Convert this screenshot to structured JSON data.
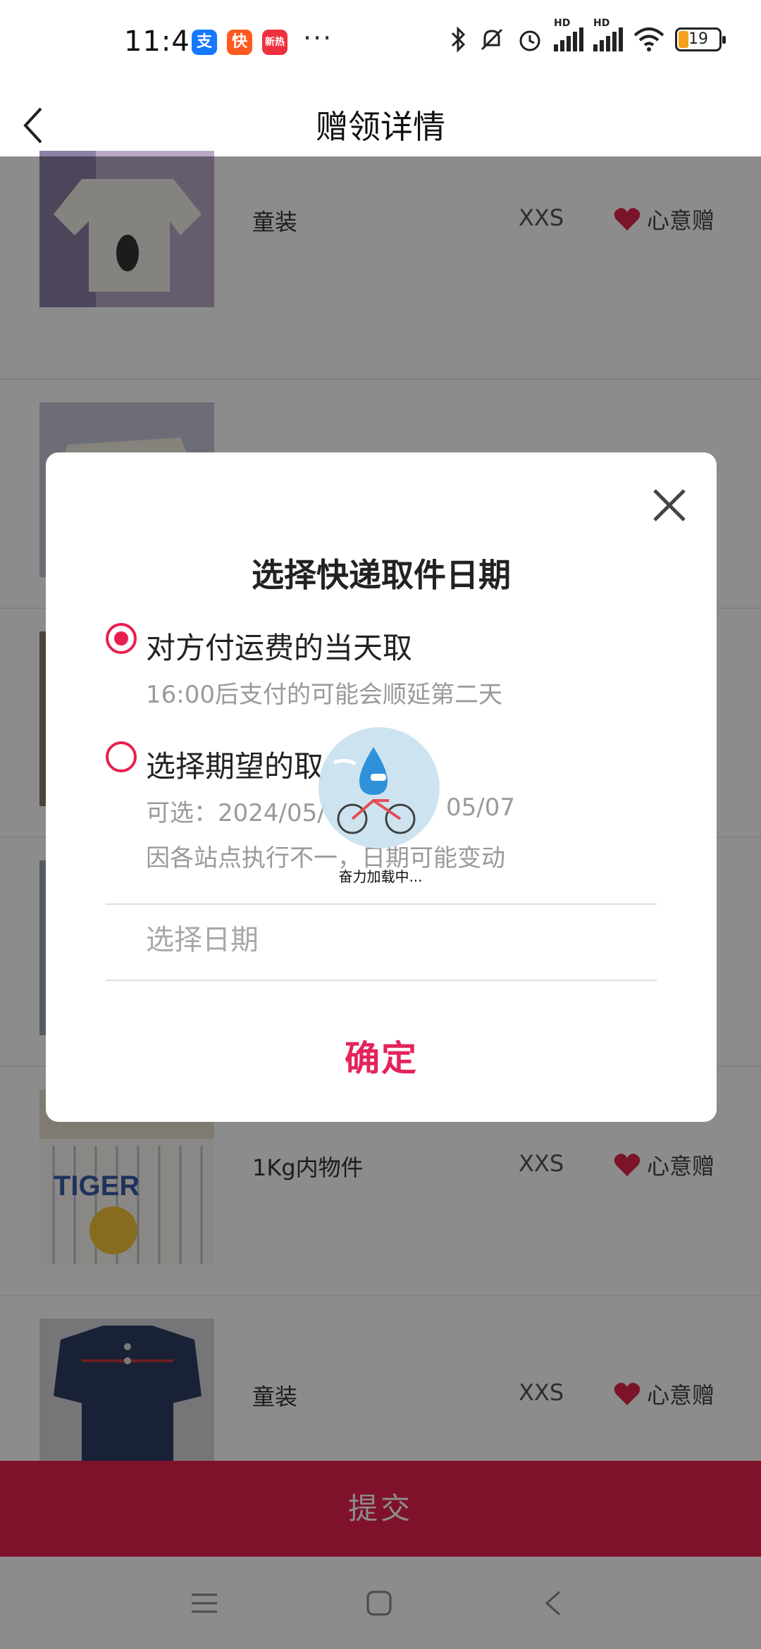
{
  "status_bar": {
    "time": "11:49",
    "app_icons": [
      "alipay-icon",
      "kuaishou-icon",
      "news-icon"
    ],
    "alipay_glyph": "支",
    "kuai_glyph": "快",
    "news_glyph": "新热",
    "more": "···",
    "battery": "19",
    "network_labels": [
      "HD",
      "HD"
    ]
  },
  "header": {
    "title": "赠领详情"
  },
  "items": [
    {
      "category": "童装",
      "size": "XXS",
      "gift_label": "心意赠"
    },
    {
      "category": "童装",
      "size": "XXS",
      "gift_label": "心意赠"
    },
    {
      "category": "1Kg内物件",
      "size": "XXS",
      "gift_label": "心意赠"
    },
    {
      "category": "童装",
      "size": "XXS",
      "gift_label": "心意赠"
    }
  ],
  "submit": {
    "label": "提交"
  },
  "dialog": {
    "title": "选择快递取件日期",
    "option1": {
      "label": "对方付运费的当天取",
      "note": "16:00后支付的可能会顺延第二天",
      "selected": true
    },
    "option2": {
      "label": "选择期望的取",
      "note_range": "可选：2024/05/",
      "note_range_end": "05/07",
      "note_warning": "因各站点执行不一，日期可能变动",
      "selected": false
    },
    "date_placeholder": "选择日期",
    "confirm_label": "确定"
  },
  "loading": {
    "text": "奋力加载中..."
  },
  "colors": {
    "accent": "#e8204f",
    "confirm": "#e3245a",
    "overlay": "rgba(0,0,0,0.45)",
    "heart": "#e0264a"
  }
}
